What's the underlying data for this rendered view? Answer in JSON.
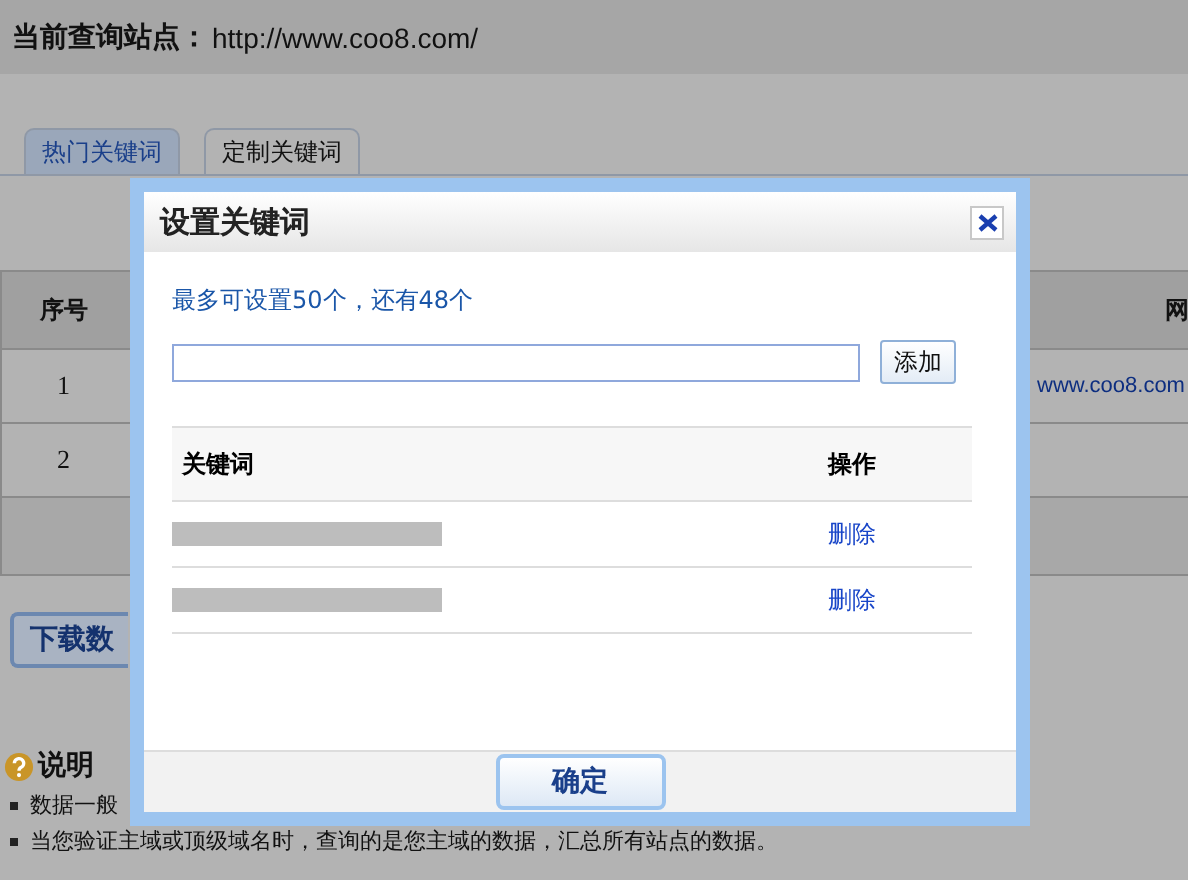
{
  "page": {
    "site_label": "当前查询站点：",
    "site_url": "http://www.coo8.com/"
  },
  "tabs": [
    {
      "label": "热门关键词",
      "selected": false
    },
    {
      "label": "定制关键词",
      "selected": true
    }
  ],
  "table": {
    "columns": [
      "序号",
      "网"
    ],
    "rows": [
      {
        "index": "1",
        "url": "www.coo8.com"
      },
      {
        "index": "2"
      }
    ]
  },
  "download_button": "下载数",
  "notes": {
    "title": "说明",
    "items": [
      "数据一般",
      "当您验证主域或顶级域名时，查询的是您主域的数据，汇总所有站点的数据。"
    ]
  },
  "dialog": {
    "title": "设置关键词",
    "info": "最多可设置50个，还有48个",
    "add_button": "添加",
    "columns": [
      "关键词",
      "操作"
    ],
    "rows": [
      {
        "action": "删除"
      },
      {
        "action": "删除"
      }
    ],
    "confirm_button": "确定"
  }
}
